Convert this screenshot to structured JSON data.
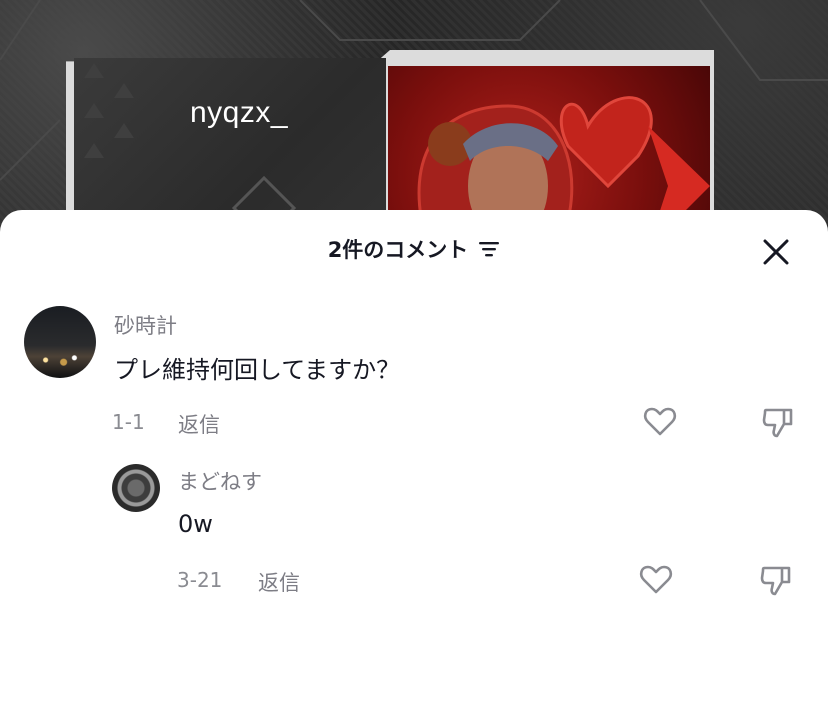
{
  "background": {
    "username": "nyqzx_"
  },
  "header": {
    "title": "2件のコメント"
  },
  "comments": [
    {
      "author": "砂時計",
      "text": "プレ維持何回してますか？",
      "date": "1-1",
      "reply_label": "返信"
    },
    {
      "author": "まどねす",
      "text": "0w",
      "date": "3-21",
      "reply_label": "返信"
    }
  ],
  "colors": {
    "text_primary": "#161823",
    "text_secondary": "#7d7d85"
  }
}
